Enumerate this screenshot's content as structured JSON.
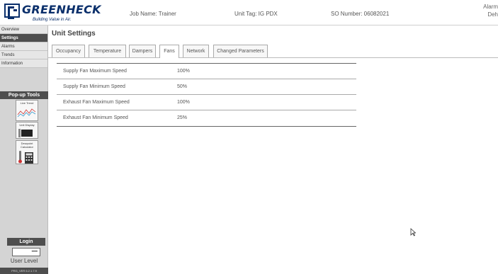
{
  "header": {
    "brand": "GREENHECK",
    "tagline": "Building Value in Air.",
    "job_name": "Job Name: Trainer",
    "unit_tag": "Unit Tag: IG PDX",
    "so_number": "SO Number: 06082021",
    "right_line1": "Alarm",
    "right_line2": "Deh"
  },
  "sidebar": {
    "items": [
      {
        "label": "Overview"
      },
      {
        "label": "Settings"
      },
      {
        "label": "Alarms"
      },
      {
        "label": "Trends"
      },
      {
        "label": "Information"
      }
    ],
    "popup_tools_title": "Pop-up Tools",
    "tools": [
      {
        "label": "Live Trend",
        "icon": "trend-chart-icon"
      },
      {
        "label": "Unit Display",
        "icon": "unit-display-icon"
      },
      {
        "label": "Dewpoint Calculator",
        "icon": "calculator-icon"
      }
    ],
    "login_title": "Login",
    "password_value": "••••",
    "user_level": "User Level",
    "version": "PRG_VER 6.2.1.7.9"
  },
  "main": {
    "title": "Unit Settings",
    "tabs": [
      {
        "label": "Occupancy"
      },
      {
        "label": "Temperature"
      },
      {
        "label": "Dampers"
      },
      {
        "label": "Fans",
        "active": true
      },
      {
        "label": "Network"
      },
      {
        "label": "Changed Parameters"
      }
    ],
    "rows": [
      {
        "label": "Supply Fan Maximum Speed",
        "value": "100%"
      },
      {
        "label": "Supply Fan Minimum Speed",
        "value": "50%"
      },
      {
        "label": "Exhaust Fan Maximum Speed",
        "value": "100%"
      },
      {
        "label": "Exhaust Fan Minimum Speed",
        "value": "25%"
      }
    ]
  },
  "colors": {
    "brand": "#0a2f6b",
    "nav_active": "#4e4e4e",
    "sidebar_bg": "#d4d4d4"
  }
}
